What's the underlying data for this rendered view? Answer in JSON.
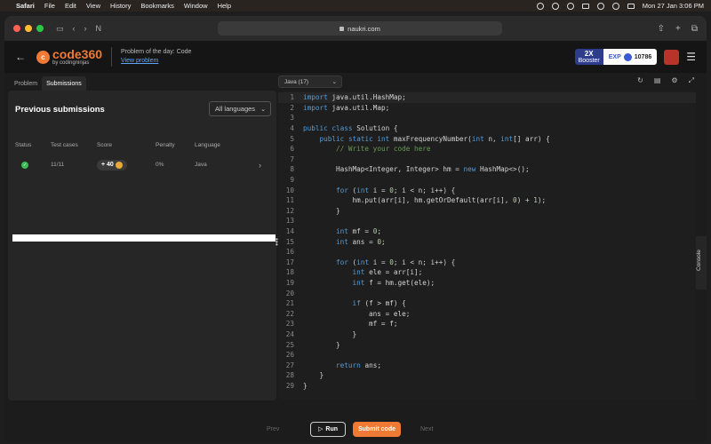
{
  "menubar": {
    "app": "Safari",
    "items": [
      "File",
      "Edit",
      "View",
      "History",
      "Bookmarks",
      "Window",
      "Help"
    ],
    "datetime": "Mon 27 Jan  3:06 PM"
  },
  "browser": {
    "url": "naukri.com"
  },
  "header": {
    "logo_main": "code360",
    "logo_sub": "by codingninjas",
    "logo_badge": "c",
    "potd_label": "Problem of the day: Code",
    "potd_link": "View problem",
    "booster_mult": "2X",
    "booster_label": "Booster",
    "exp_label": "EXP",
    "exp_value": "10786"
  },
  "tabs": [
    {
      "label": "Problem"
    },
    {
      "label": "Submissions"
    }
  ],
  "submissions": {
    "title": "Previous submissions",
    "language_filter": "All languages",
    "columns": [
      "Status",
      "Test cases",
      "Score",
      "Penalty",
      "Language"
    ],
    "rows": [
      {
        "status": "accepted",
        "test_cases": "11/11",
        "score": "+ 40",
        "penalty": "0%",
        "language": "Java"
      }
    ]
  },
  "editor": {
    "language": "Java (17)",
    "lines": [
      "1",
      "2",
      "3",
      "4",
      "5",
      "6",
      "7",
      "8",
      "9",
      "10",
      "11",
      "12",
      "13",
      "14",
      "15",
      "16",
      "17",
      "18",
      "19",
      "20",
      "21",
      "22",
      "23",
      "24",
      "25",
      "26",
      "27",
      "28",
      "29"
    ],
    "code": [
      "import java.util.HashMap;",
      "import java.util.Map;",
      "",
      "public class Solution {",
      "    public static int maxFrequencyNumber(int n, int[] arr) {",
      "        // Write your code here",
      "",
      "        HashMap<Integer, Integer> hm = new HashMap<>();",
      "",
      "        for (int i = 0; i < n; i++) {",
      "            hm.put(arr[i], hm.getOrDefault(arr[i], 0) + 1);",
      "        }",
      "",
      "        int mf = 0;",
      "        int ans = 0;",
      "",
      "        for (int i = 0; i < n; i++) {",
      "            int ele = arr[i];",
      "            int f = hm.get(ele);",
      "",
      "            if (f > mf) {",
      "                ans = ele;",
      "                mf = f;",
      "            }",
      "        }",
      "",
      "        return ans;",
      "    }",
      "}"
    ]
  },
  "console_label": "Console",
  "footer": {
    "prev": "Prev",
    "run": "Run",
    "submit": "Submit code",
    "next": "Next"
  },
  "colors": {
    "accent": "#f07a34",
    "success": "#3cba54",
    "booster": "#2d3d8c"
  }
}
